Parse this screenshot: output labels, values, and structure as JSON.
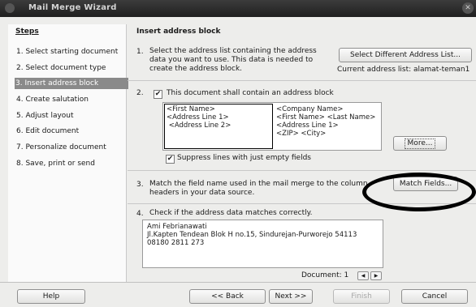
{
  "window": {
    "title": "Mail Merge Wizard"
  },
  "sidebar": {
    "heading": "Steps",
    "items": [
      {
        "label": "1. Select starting document"
      },
      {
        "label": "2. Select document type"
      },
      {
        "label": "3. Insert address block"
      },
      {
        "label": "4. Create salutation"
      },
      {
        "label": "5. Adjust layout"
      },
      {
        "label": "6. Edit document"
      },
      {
        "label": "7. Personalize document"
      },
      {
        "label": "8. Save, print or send"
      }
    ]
  },
  "main": {
    "title": "Insert address block",
    "step1": {
      "num": "1.",
      "text_lines": [
        "Select the address list containing the address",
        "data you want to use. This data is needed to",
        "create the address block."
      ],
      "button": "Select Different Address List...",
      "current": "Current address list: alamat-teman1"
    },
    "step2": {
      "num": "2.",
      "checkbox_label": "This document shall contain an address block",
      "checkbox_checked": true,
      "block_a": [
        "<First Name>",
        "<Address Line 1>",
        " <Address Line 2>"
      ],
      "block_b": [
        "<Company Name>",
        "<First Name> <Last Name>",
        "<Address Line 1>",
        "<ZIP> <City>"
      ],
      "more_button": "More...",
      "suppress_label": "Suppress lines with just empty fields",
      "suppress_checked": true
    },
    "step3": {
      "num": "3.",
      "text_lines": [
        "Match the field name used in the mail merge to the column",
        "headers in your data source."
      ],
      "button": "Match Fields..."
    },
    "step4": {
      "num": "4.",
      "text": "Check if the address data matches correctly.",
      "preview_lines": [
        "Ami Febrianawati",
        "Jl.Kapten Tendean Blok H no.15, Sindurejan-Purworejo 54113",
        " 08180 2811 273"
      ],
      "document_label": "Document: 1"
    }
  },
  "footer": {
    "help": "Help",
    "back": "<< Back",
    "next": "Next >>",
    "finish": "Finish",
    "cancel": "Cancel"
  }
}
